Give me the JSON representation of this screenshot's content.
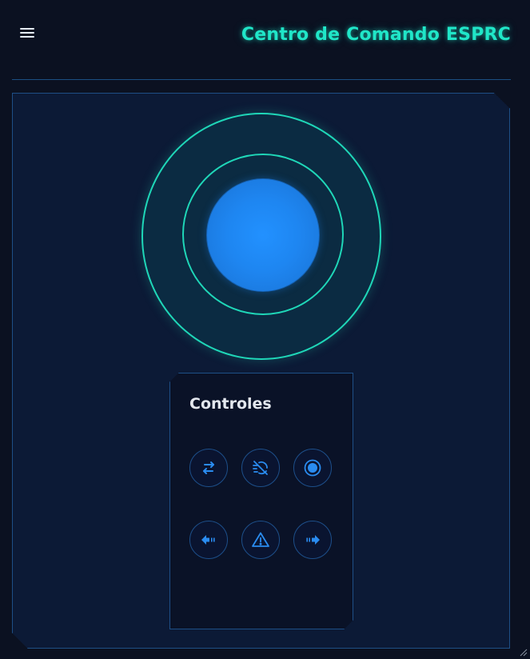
{
  "header": {
    "title": "Centro de Comando ESPRC",
    "menu_icon": "hamburger-menu-icon"
  },
  "joystick": {
    "ring_color": "#1fd7b8",
    "knob_color": "#1e86f1"
  },
  "controls": {
    "title": "Controles",
    "buttons": [
      {
        "name": "swap-direction",
        "icon": "arrows-swap-icon"
      },
      {
        "name": "speed-off",
        "icon": "wind-off-icon"
      },
      {
        "name": "record",
        "icon": "record-icon"
      },
      {
        "name": "left-signal",
        "icon": "arrow-left-icon"
      },
      {
        "name": "hazard",
        "icon": "warning-triangle-icon"
      },
      {
        "name": "right-signal",
        "icon": "arrow-right-icon"
      }
    ]
  },
  "colors": {
    "background": "#0b1121",
    "panel": "#0c1a36",
    "accent": "#20e6c8",
    "icon": "#2a8cf0",
    "border": "#1e4f86"
  }
}
